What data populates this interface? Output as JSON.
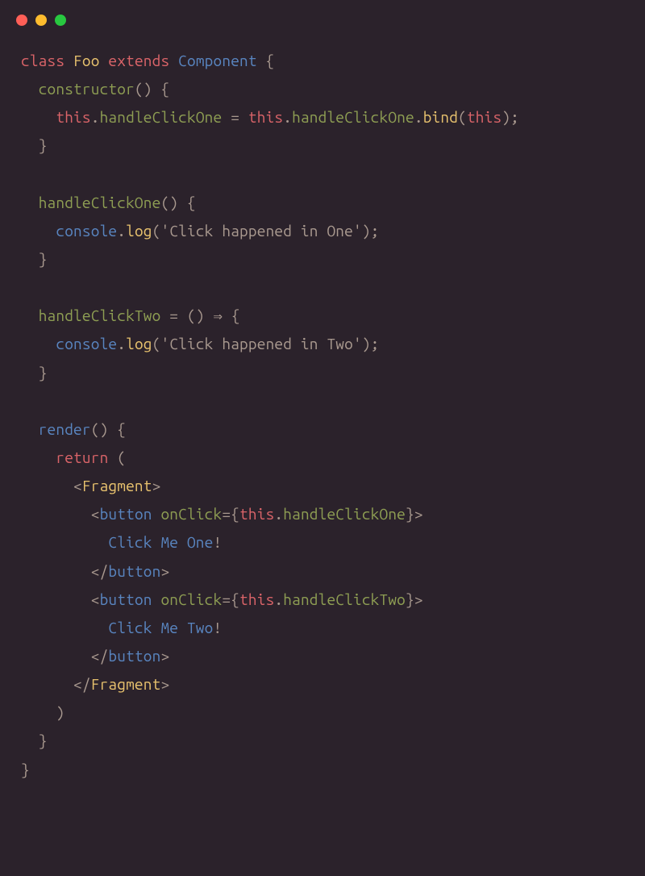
{
  "titlebar": {
    "close": "close",
    "minimize": "minimize",
    "maximize": "maximize"
  },
  "code": {
    "l1_class": "class",
    "l1_foo": "Foo",
    "l1_extends": "extends",
    "l1_component": "Component",
    "l1_brace": " {",
    "l2_constructor": "constructor",
    "l2_parens": "() {",
    "l3_this1": "this",
    "l3_dot1": ".",
    "l3_handle1": "handleClickOne",
    "l3_eq": " = ",
    "l3_this2": "this",
    "l3_dot2": ".",
    "l3_handle2": "handleClickOne",
    "l3_dot3": ".",
    "l3_bind": "bind",
    "l3_open": "(",
    "l3_this3": "this",
    "l3_close": ");",
    "l4_close": "}",
    "l6_handle": "handleClickOne",
    "l6_parens": "() {",
    "l7_console": "console",
    "l7_dot": ".",
    "l7_log": "log",
    "l7_open": "(",
    "l7_str": "'Click happened in One'",
    "l7_close": ");",
    "l8_close": "}",
    "l10_handle": "handleClickTwo",
    "l10_eq": " = () ",
    "l10_arrow": "⇒",
    "l10_brace": " {",
    "l11_console": "console",
    "l11_dot": ".",
    "l11_log": "log",
    "l11_open": "(",
    "l11_str": "'Click happened in Two'",
    "l11_close": ");",
    "l12_close": "}",
    "l14_render": "render",
    "l14_parens": "() {",
    "l15_return": "return",
    "l15_paren": " (",
    "l16_open": "<",
    "l16_frag": "Fragment",
    "l16_close": ">",
    "l17_open": "<",
    "l17_button": "button",
    "l17_sp": " ",
    "l17_onclick": "onClick",
    "l17_eq": "=",
    "l17_brace1": "{",
    "l17_this": "this",
    "l17_dot": ".",
    "l17_handle": "handleClickOne",
    "l17_brace2": "}",
    "l17_gt": ">",
    "l18_text": "Click Me One",
    "l18_excl": "!",
    "l19_close": "</",
    "l19_button": "button",
    "l19_gt": ">",
    "l20_open": "<",
    "l20_button": "button",
    "l20_sp": " ",
    "l20_onclick": "onClick",
    "l20_eq": "=",
    "l20_brace1": "{",
    "l20_this": "this",
    "l20_dot": ".",
    "l20_handle": "handleClickTwo",
    "l20_brace2": "}",
    "l20_gt": ">",
    "l21_text": "Click Me Two",
    "l21_excl": "!",
    "l22_close": "</",
    "l22_button": "button",
    "l22_gt": ">",
    "l23_close": "</",
    "l23_frag": "Fragment",
    "l23_gt": ">",
    "l24_paren": ")",
    "l25_close": "}",
    "l26_close": "}"
  }
}
